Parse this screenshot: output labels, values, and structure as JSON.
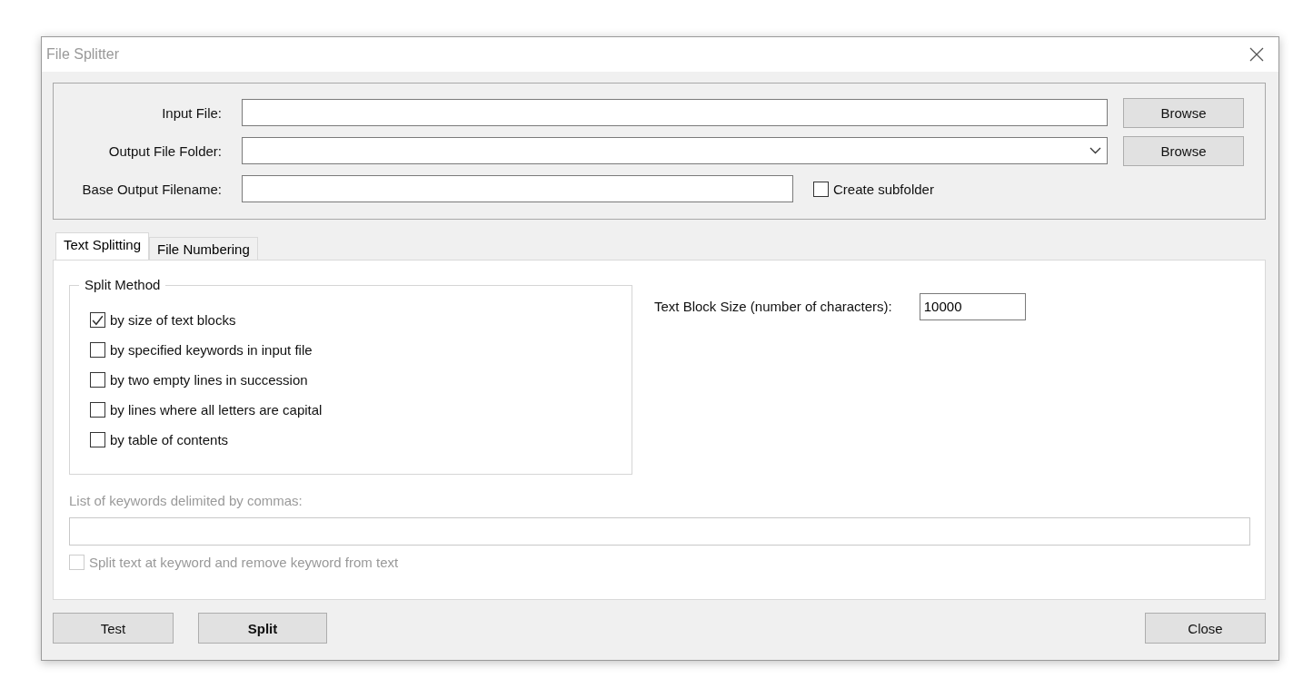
{
  "window": {
    "title": "File Splitter"
  },
  "fields": [
    {
      "kind": "text",
      "label": "Input File:",
      "button": "Browse"
    },
    {
      "kind": "combo",
      "label": "Output File Folder:",
      "button": "Browse"
    },
    {
      "kind": "short",
      "label": "Base Output Filename:",
      "checkbox": {
        "label": "Create subfolder",
        "checked": false
      }
    }
  ],
  "tabs": [
    {
      "label": "Text Splitting",
      "selected": true
    },
    {
      "label": "File Numbering",
      "selected": false
    }
  ],
  "split_method": {
    "title": "Split Method",
    "options": [
      {
        "label": "by size of text blocks",
        "checked": true
      },
      {
        "label": "by specified keywords in input file",
        "checked": false
      },
      {
        "label": "by two empty lines in succession",
        "checked": false
      },
      {
        "label": "by lines where all letters are capital",
        "checked": false
      },
      {
        "label": "by table of contents",
        "checked": false
      }
    ]
  },
  "block_size": {
    "label": "Text Block Size (number of characters):",
    "value": "10000"
  },
  "keywords": {
    "label": "List of keywords delimited by commas:",
    "disabled": true,
    "checkbox": {
      "label": "Split text at keyword and remove keyword from text",
      "checked": false,
      "disabled": true
    }
  },
  "buttons": [
    {
      "label": "Test",
      "bold": false
    },
    {
      "label": "Split",
      "bold": true
    }
  ],
  "close_button": "Close"
}
